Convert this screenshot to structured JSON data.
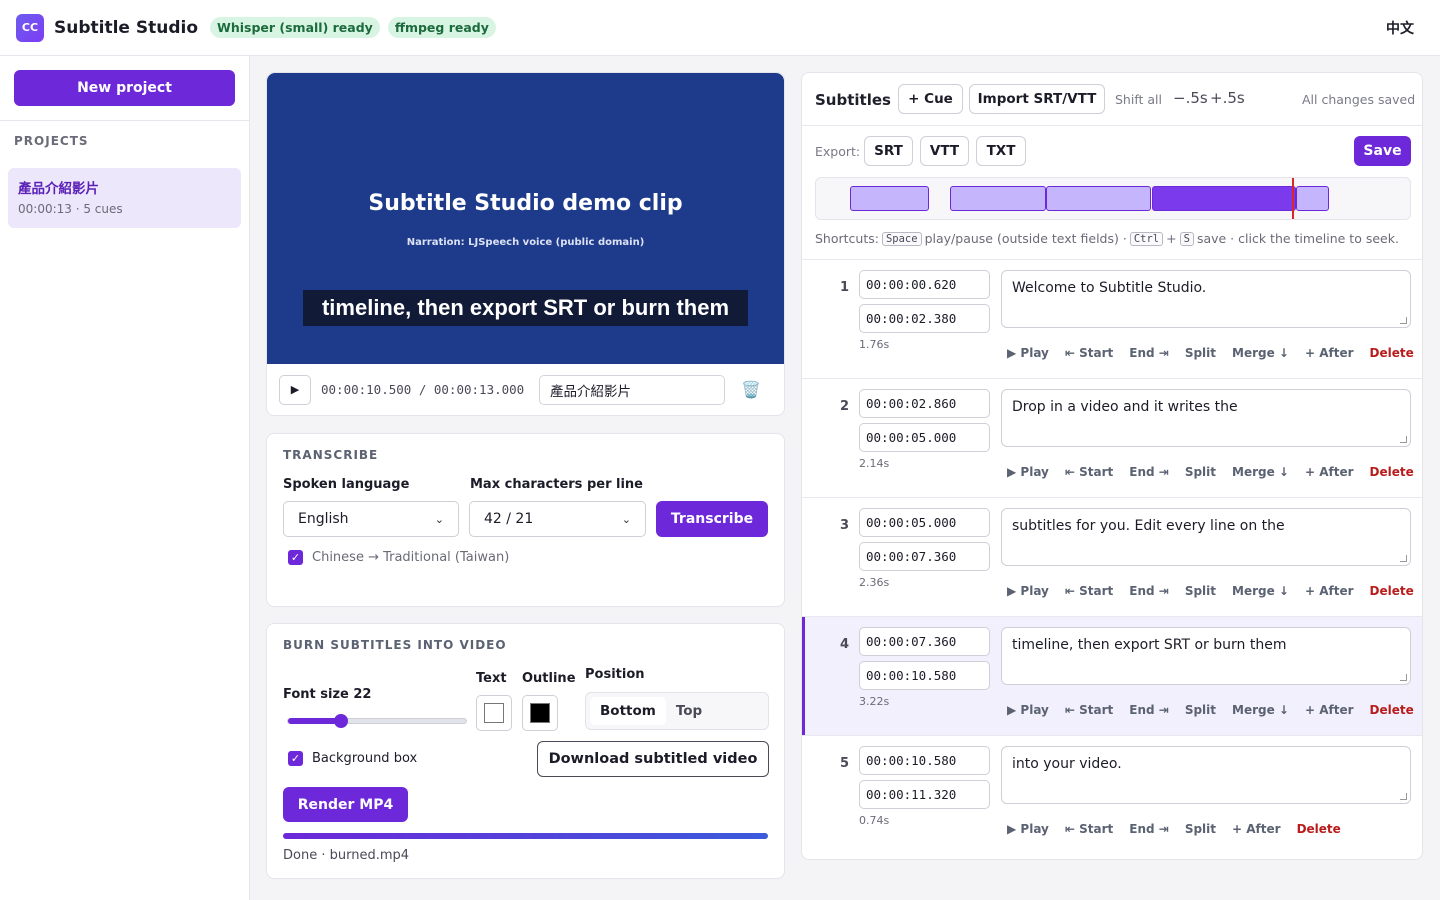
{
  "app": {
    "logo": "CC",
    "title": "Subtitle Studio",
    "lang_toggle": "中文"
  },
  "status_pills": [
    "Whisper (small) ready",
    "ffmpeg ready"
  ],
  "sidebar": {
    "new_project_label": "New project",
    "projects_heading": "PROJECTS",
    "projects": [
      {
        "name": "產品介紹影片",
        "meta": "00:00:13 · 5 cues"
      }
    ]
  },
  "player": {
    "title": "Subtitle Studio demo clip",
    "subline": "Narration: LJSpeech voice (public domain)",
    "burned_subtitle": "timeline, then export SRT or burn them",
    "play_glyph": "▶",
    "timecode": "00:00:10.500 / 00:00:13.000",
    "project_name_value": "產品介紹影片",
    "trash_icon": "🗑️"
  },
  "transcribe": {
    "heading": "TRANSCRIBE",
    "language_label": "Spoken language",
    "language_value": "English",
    "maxchars_label": "Max characters per line",
    "maxchars_value": "42 / 21",
    "button_label": "Transcribe",
    "chinese_option_label": "Chinese → Traditional (Taiwan)",
    "chinese_option_checked": true
  },
  "burn": {
    "heading": "BURN SUBTITLES INTO VIDEO",
    "font_size_label": "Font size 22",
    "font_size_level": 0.3,
    "text_color_label": "Text",
    "text_color": "#ffffff",
    "outline_color_label": "Outline",
    "outline_color": "#000000",
    "position_label": "Position",
    "position_options": [
      "Bottom",
      "Top"
    ],
    "position_selected": "Bottom",
    "background_box_label": "Background box",
    "background_box_checked": true,
    "download_label": "Download subtitled video",
    "render_label": "Render MP4",
    "progress": 1.0,
    "status": "Done · burned.mp4"
  },
  "subtitles": {
    "title": "Subtitles",
    "add_cue_label": "+ Cue",
    "import_label": "Import SRT/VTT",
    "shift_label": "Shift all",
    "shift_minus": "−.5s",
    "shift_plus": "+.5s",
    "saved_status": "All changes saved",
    "export_label": "Export:",
    "export_formats": [
      "SRT",
      "VTT",
      "TXT"
    ],
    "save_label": "Save",
    "timeline": {
      "duration": 13.0,
      "playhead": 10.5,
      "active_index": 3
    },
    "shortcuts": {
      "prefix": "Shortcuts:",
      "space_key": "Space",
      "space_desc": "play/pause (outside text fields) ·",
      "ctrl_key": "Ctrl",
      "plus": "+",
      "s_key": "S",
      "save_desc": "save · click the timeline to seek."
    },
    "cue_actions": [
      "▶ Play",
      "⇤ Start",
      "End ⇥",
      "Split",
      "Merge ↓",
      "+ After",
      "Delete"
    ],
    "last_cue_actions": [
      "▶ Play",
      "⇤ Start",
      "End ⇥",
      "Split",
      "+ After",
      "Delete"
    ],
    "cues": [
      {
        "num": "1",
        "start": "00:00:00.620",
        "end": "00:00:02.380",
        "duration": "1.76s",
        "text": "Welcome to Subtitle Studio.",
        "start_s": 0.62,
        "end_s": 2.38
      },
      {
        "num": "2",
        "start": "00:00:02.860",
        "end": "00:00:05.000",
        "duration": "2.14s",
        "text": "Drop in a video and it writes the",
        "start_s": 2.86,
        "end_s": 5.0
      },
      {
        "num": "3",
        "start": "00:00:05.000",
        "end": "00:00:07.360",
        "duration": "2.36s",
        "text": "subtitles for you. Edit every line on the",
        "start_s": 5.0,
        "end_s": 7.36
      },
      {
        "num": "4",
        "start": "00:00:07.360",
        "end": "00:00:10.580",
        "duration": "3.22s",
        "text": "timeline, then export SRT or burn them",
        "start_s": 7.36,
        "end_s": 10.58
      },
      {
        "num": "5",
        "start": "00:00:10.580",
        "end": "00:00:11.320",
        "duration": "0.74s",
        "text": "into your video.",
        "start_s": 10.58,
        "end_s": 11.32
      }
    ]
  },
  "colors": {
    "accent": "#6d28d9",
    "video_bg": "#1e3a8a",
    "ready_pill_bg": "#d8f5e3",
    "ready_pill_text": "#1c6b3c",
    "danger": "#b91c1c",
    "playhead": "#dc2626"
  }
}
